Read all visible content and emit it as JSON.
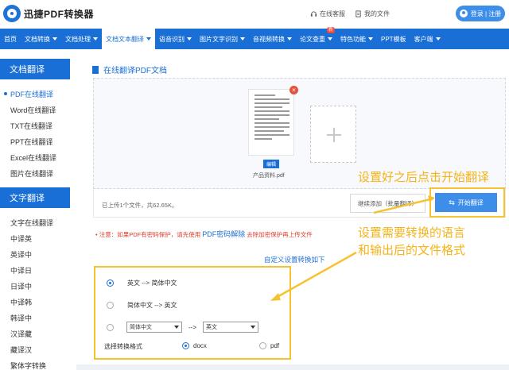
{
  "header": {
    "logo_text": "迅捷PDF转换器",
    "service_label": "在线客服",
    "docs_label": "我的文件",
    "login_label": "登录 | 注册"
  },
  "nav": {
    "items": [
      {
        "label": "首页",
        "dropdown": false,
        "active": false
      },
      {
        "label": "文档转换",
        "dropdown": true,
        "active": false
      },
      {
        "label": "文档处理",
        "dropdown": true,
        "active": false
      },
      {
        "label": "文档文本翻译",
        "dropdown": true,
        "active": true
      },
      {
        "label": "语音识别",
        "dropdown": true,
        "active": false
      },
      {
        "label": "图片文字识别",
        "dropdown": true,
        "active": false
      },
      {
        "label": "音视频转换",
        "dropdown": true,
        "active": false
      },
      {
        "label": "论文查重",
        "dropdown": true,
        "active": false,
        "badge": "新"
      },
      {
        "label": "特色功能",
        "dropdown": true,
        "active": false
      },
      {
        "label": "PPT模板",
        "dropdown": false,
        "active": false
      },
      {
        "label": "客户端",
        "dropdown": true,
        "active": false
      }
    ]
  },
  "sidebar": {
    "doc_head": "文档翻译",
    "doc_items": [
      "PDF在线翻译",
      "Word在线翻译",
      "TXT在线翻译",
      "PPT在线翻译",
      "Excel在线翻译",
      "图片在线翻译"
    ],
    "text_head": "文字翻译",
    "text_items": [
      "文字在线翻译",
      "中译英",
      "英译中",
      "中译日",
      "日译中",
      "中译韩",
      "韩译中",
      "汉译藏",
      "藏译汉",
      "繁体字转换"
    ]
  },
  "main": {
    "title": "在线翻译PDF文档",
    "file_name": "产品资料.pdf",
    "edit_label": "编辑",
    "upload_info": "已上传1个文件，共62.65K。",
    "continue_label": "继续添加（批量翻译）",
    "start_label": "开始翻译",
    "notice_prefix": "• 注意：如果PDF有密码保护，请先使用",
    "notice_link": "PDF密码解除",
    "notice_suffix": "去除加密保护再上传文件",
    "custom_label": "自定义设置转换如下"
  },
  "options": {
    "opt1": "英文 --> 简体中文",
    "opt2": "简体中文 --> 英文",
    "from_value": "简体中文",
    "arrow": "-->",
    "to_value": "英文",
    "format_label": "选择转换格式",
    "format_docx": "docx",
    "format_pdf": "pdf"
  },
  "annotations": {
    "tip1": "设置好之后点击开始翻译",
    "tip2_line1": "设置需要转换的语言",
    "tip2_line2": "和输出后的文件格式"
  },
  "colors": {
    "brand": "#1a6fd6",
    "highlight": "#f5c330",
    "notice": "#e03b2d"
  }
}
